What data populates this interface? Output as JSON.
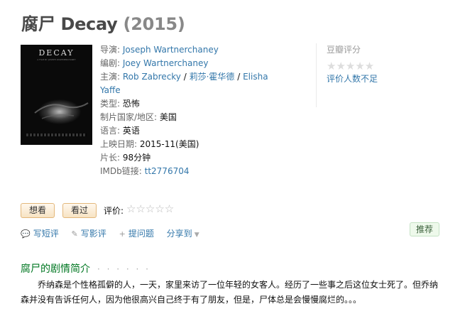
{
  "title": {
    "name": "腐尸 Decay",
    "year": "(2015)"
  },
  "poster": {
    "title_text": "DECAY",
    "subtitle_text": "A FILM BY JOSEPH WARTNERCHANEY"
  },
  "info": {
    "director_label": "导演:",
    "director": "Joseph Wartnerchaney",
    "writer_label": "编剧:",
    "writer": "Joey Wartnerchaney",
    "cast_label": "主演:",
    "cast": [
      "Rob Zabrecky",
      "莉莎·霍华德",
      "Elisha Yaffe"
    ],
    "cast_sep": " / ",
    "genre_label": "类型:",
    "genre": "恐怖",
    "country_label": "制片国家/地区:",
    "country": "美国",
    "language_label": "语言:",
    "language": "英语",
    "release_label": "上映日期:",
    "release": "2015-11(美国)",
    "runtime_label": "片长:",
    "runtime": "98分钟",
    "imdb_label": "IMDb链接:",
    "imdb": "tt2776704"
  },
  "rating": {
    "title": "豆瓣评分",
    "stars": "★★★★★",
    "note": "评价人数不足"
  },
  "buttons": {
    "want": "想看",
    "seen": "看过"
  },
  "my_rating": {
    "label": "评价:",
    "stars": "☆☆☆☆☆"
  },
  "actions": [
    {
      "icon": "💬",
      "label": "写短评",
      "name": "write-comment"
    },
    {
      "icon": "✎",
      "label": "写影评",
      "name": "write-review"
    },
    {
      "icon": "+",
      "label": "提问题",
      "name": "ask-question"
    },
    {
      "icon": "",
      "label": "分享到",
      "name": "share-to"
    }
  ],
  "share_caret": "▼",
  "recommend": "推荐",
  "synopsis": {
    "heading": "腐尸的剧情简介",
    "dots": "· · · · · ·",
    "text": "乔纳森是个性格孤僻的人，一天，家里来访了一位年轻的女客人。经历了一些事之后这位女士死了。但乔纳森并没有告诉任何人，因为他很高兴自己终于有了朋友，但是，尸体总是会慢慢腐烂的。。。"
  }
}
